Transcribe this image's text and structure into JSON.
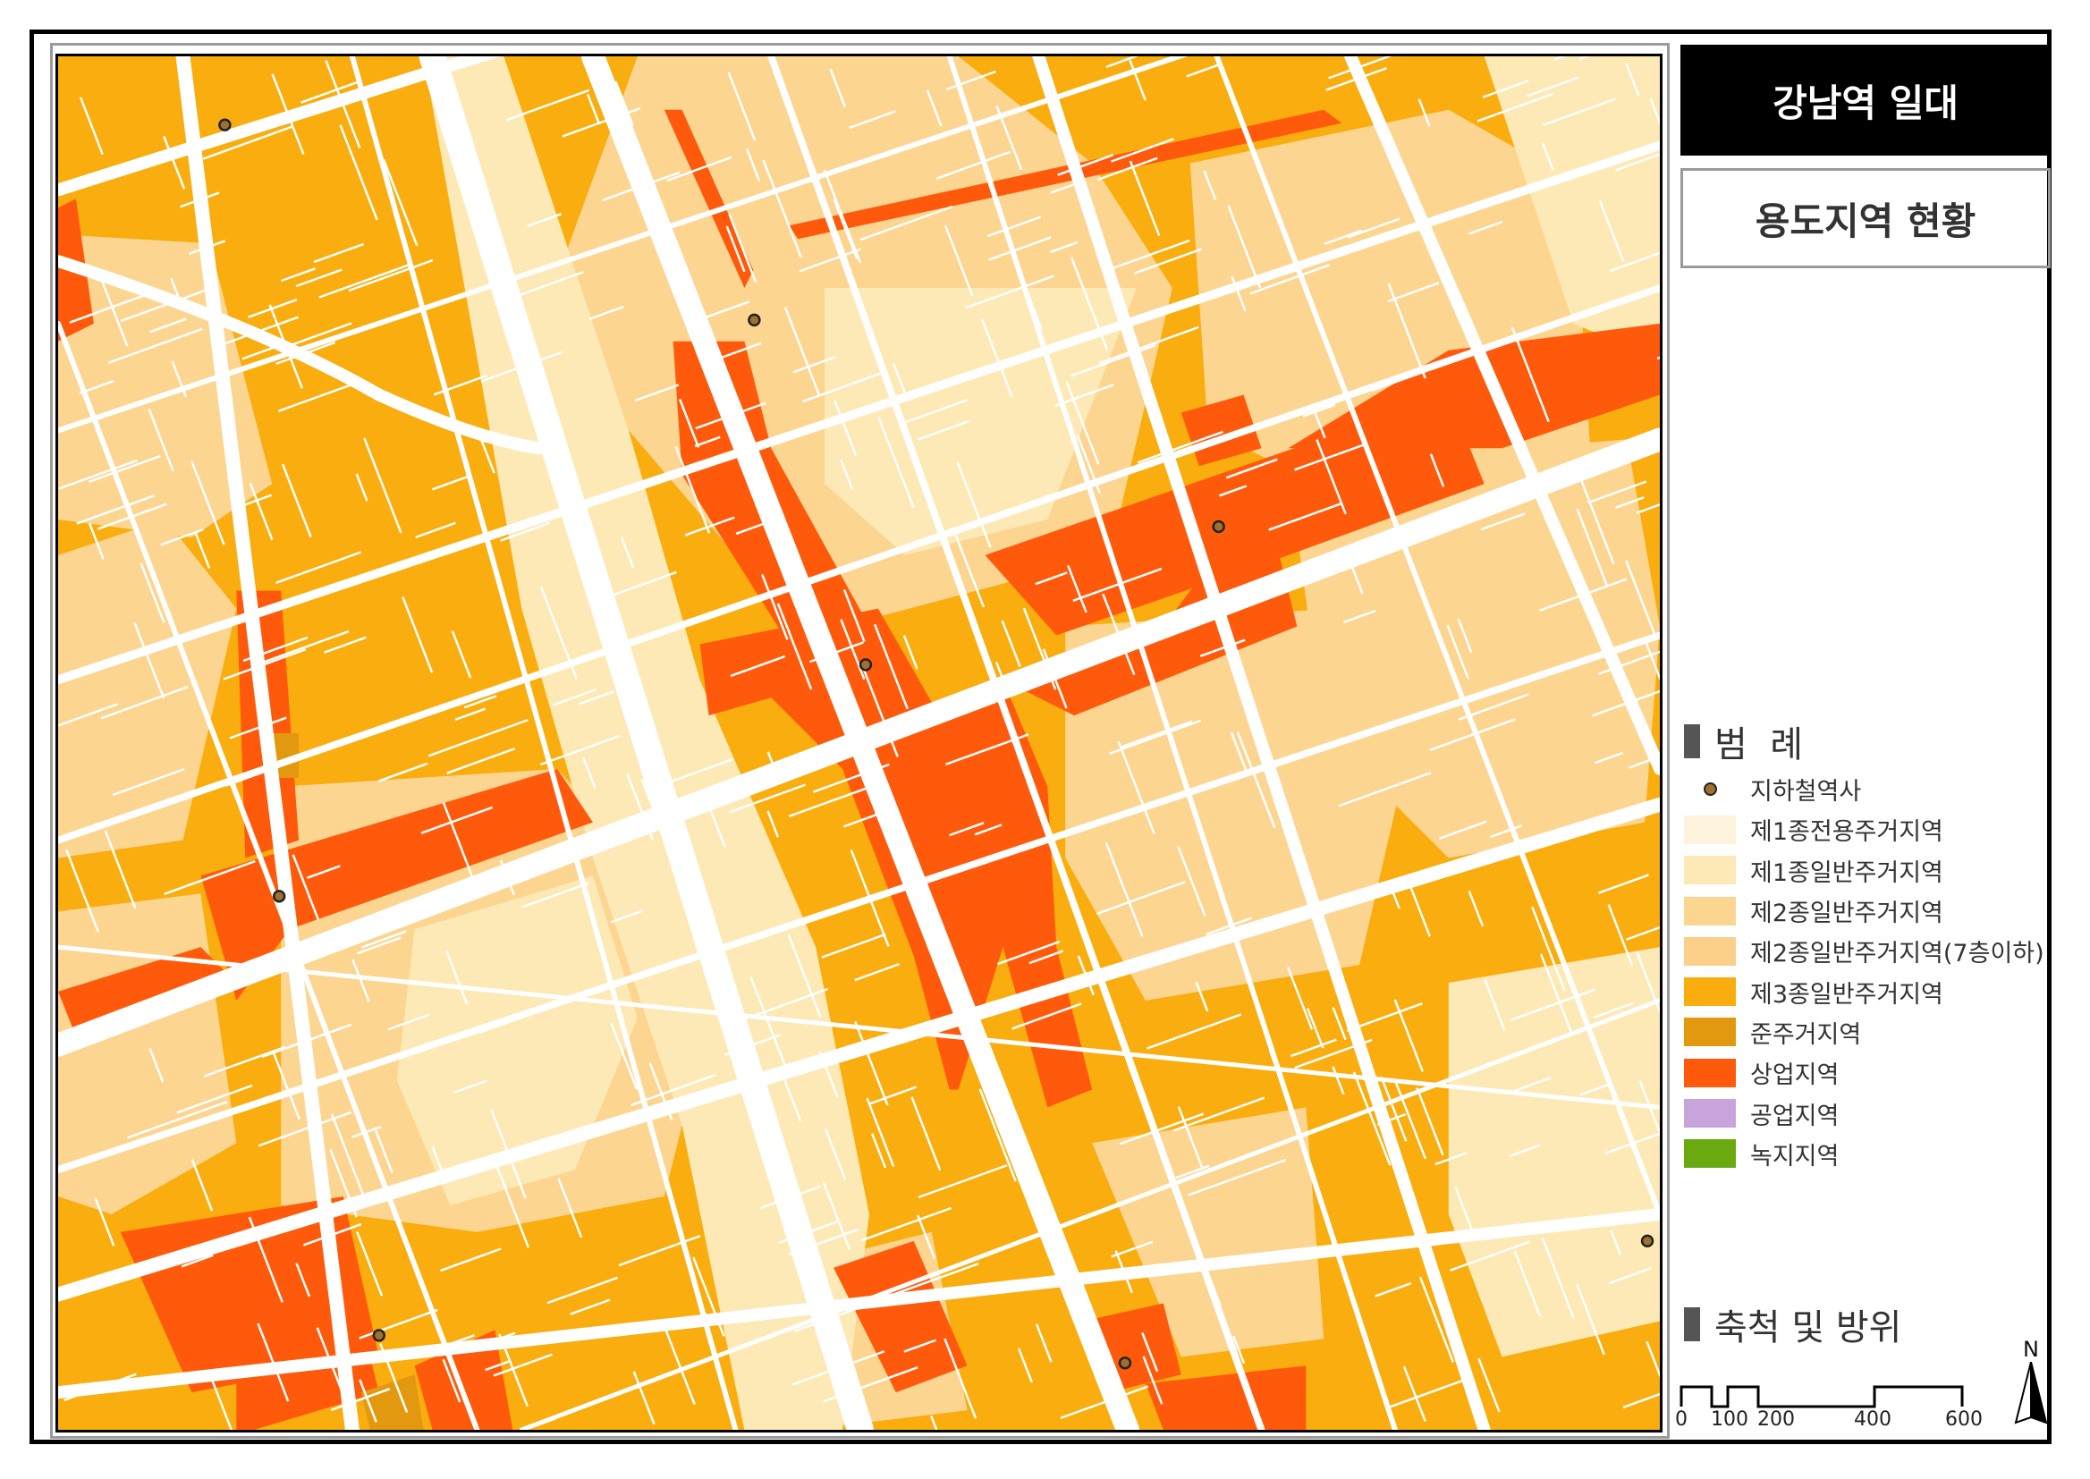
{
  "title": "강남역 일대",
  "subtitle": "용도지역 현황",
  "legend": {
    "heading": "범  례",
    "items": [
      {
        "label": "지하철역사",
        "type": "point",
        "color": "#a07030"
      },
      {
        "label": "제1종전용주거지역",
        "color": "#fdf3dc"
      },
      {
        "label": "제1종일반주거지역",
        "color": "#fde9b5"
      },
      {
        "label": "제2종일반주거지역",
        "color": "#fcd591"
      },
      {
        "label": "제2종일반주거지역(7층이하)",
        "color": "#fcd08a"
      },
      {
        "label": "제3종일반주거지역",
        "color": "#f9ad0e"
      },
      {
        "label": "준주거지역",
        "color": "#e3990f"
      },
      {
        "label": "상업지역",
        "color": "#ff5a0b"
      },
      {
        "label": "공업지역",
        "color": "#c8a3dc"
      },
      {
        "label": "녹지지역",
        "color": "#6aaa10"
      }
    ]
  },
  "scale": {
    "heading": "축척 및 방위",
    "ticks": [
      "0",
      "100",
      "200",
      "400",
      "600"
    ]
  },
  "north_label": "N"
}
